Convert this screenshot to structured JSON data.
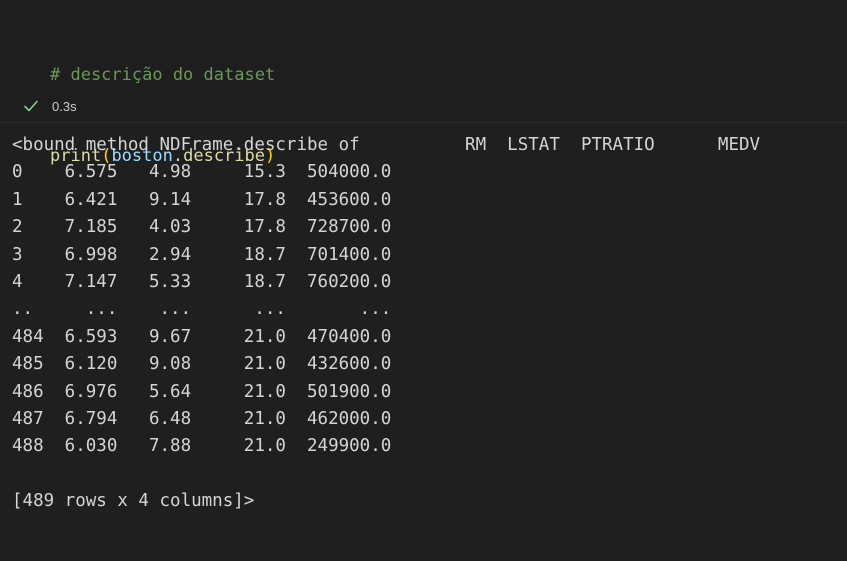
{
  "input_cell": {
    "comment": "# descrição do dataset",
    "code": {
      "func": "print",
      "open_paren": "(",
      "object": "boston",
      "dot": ".",
      "attr": "describe",
      "close_paren": ")"
    }
  },
  "status": {
    "icon": "checkmark-icon",
    "execution_time": "0.3s",
    "color": "#89d185"
  },
  "output": {
    "header": "<bound method NDFrame.describe of          RM  LSTAT  PTRATIO      MEDV",
    "rows": [
      "0    6.575   4.98     15.3  504000.0",
      "1    6.421   9.14     17.8  453600.0",
      "2    7.185   4.03     17.8  728700.0",
      "3    6.998   2.94     18.7  701400.0",
      "4    7.147   5.33     18.7  760200.0",
      "..     ...    ...      ...       ...",
      "484  6.593   9.67     21.0  470400.0",
      "485  6.120   9.08     21.0  432600.0",
      "486  6.976   5.64     21.0  501900.0",
      "487  6.794   6.48     21.0  462000.0",
      "488  6.030   7.88     21.0  249900.0"
    ],
    "footer": "[489 rows x 4 columns]>"
  }
}
